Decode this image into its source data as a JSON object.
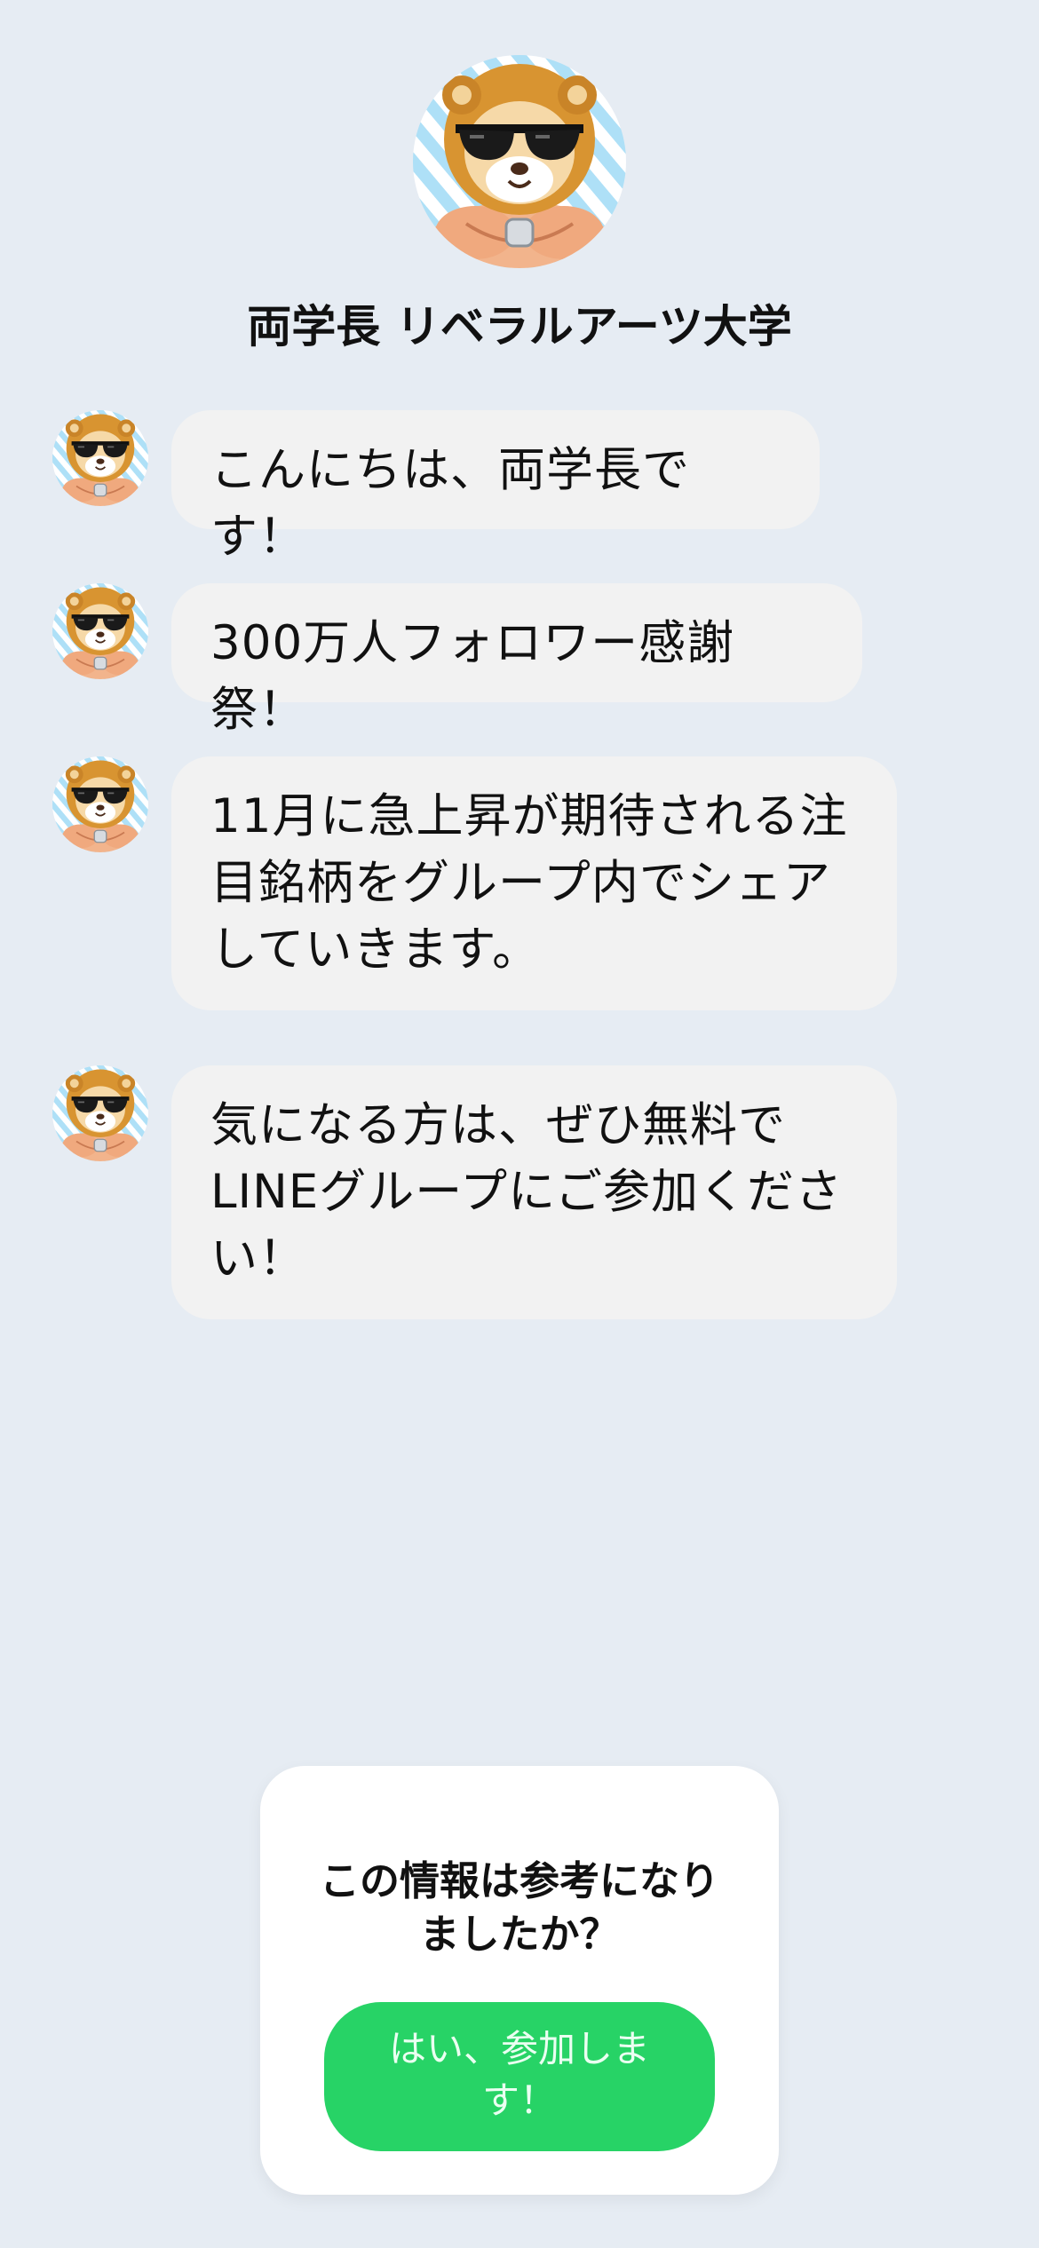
{
  "header": {
    "avatar_icon": "lion-mascot-avatar-icon",
    "title": "両学長 リベラルアーツ大学"
  },
  "messages": [
    {
      "text": "こんにちは、両学長です！"
    },
    {
      "text": "300万人フォロワー感謝祭！"
    },
    {
      "text": "11月に急上昇が期待される注\n目銘柄をグループ内でシェア\nしていきます。"
    },
    {
      "text": "気になる方は、ぜひ無料で\nLINEグループにご参加くださ\nい！"
    }
  ],
  "feedback": {
    "question": "この情報は参考になり\nましたか？",
    "button_label": "はい、参加しま\nす！",
    "button_color": "#27d366"
  },
  "colors": {
    "background": "#e6ecf3",
    "bubble": "#f2f2f2",
    "card": "#ffffff"
  }
}
